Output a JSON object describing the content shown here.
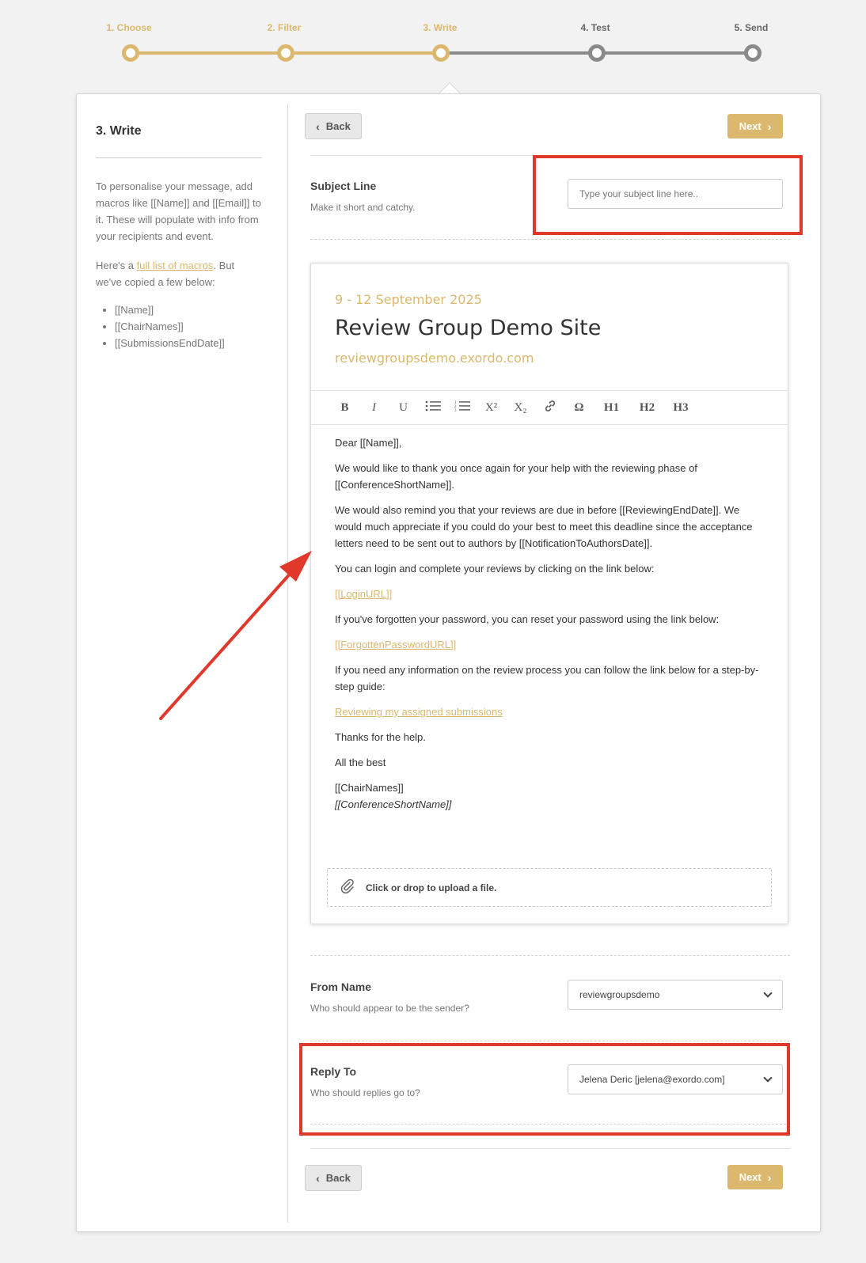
{
  "stepper": {
    "steps": [
      {
        "label": "1. Choose"
      },
      {
        "label": "2. Filter"
      },
      {
        "label": "3. Write"
      },
      {
        "label": "4. Test"
      },
      {
        "label": "5. Send"
      }
    ],
    "current_step": 3
  },
  "sidebar": {
    "title": "3. Write",
    "intro": "To personalise your message, add macros like [[Name]] and [[Email]] to it. These will populate with info from your recipients and event.",
    "macros_prefix": "Here's a ",
    "macros_link": "full list of macros",
    "macros_suffix": ". But we've copied a few below:",
    "macros": [
      "[[Name]]",
      "[[ChairNames]]",
      "[[SubmissionsEndDate]]"
    ]
  },
  "nav": {
    "back_label": "Back",
    "next_label": "Next"
  },
  "subject": {
    "label": "Subject Line",
    "help": "Make it short and catchy.",
    "placeholder": "Type your subject line here.."
  },
  "email": {
    "date": "9 - 12 September 2025",
    "title": "Review Group Demo Site",
    "url": "reviewgroupsdemo.exordo.com",
    "toolbar": [
      "B",
      "I",
      "U",
      "bullet-list",
      "numbered-list",
      "X²",
      "X₂",
      "link",
      "Ω",
      "H1",
      "H2",
      "H3"
    ],
    "greeting": "Dear [[Name]],",
    "p1": "We would like to thank you once again for your help with the reviewing phase of [[ConferenceShortName]].",
    "p2": "We would also remind you that your reviews are due in before [[ReviewingEndDate]]. We would much appreciate if you could do your best to meet this deadline since the acceptance letters need to be sent out to authors by [[NotificationToAuthorsDate]].",
    "p3": "You can login and complete your reviews by clicking on the link below:",
    "login_link": "[[LoginURL]]",
    "p4": "If you've forgotten your password, you can reset your password using the link below:",
    "forgot_link": "[[ForgottenPasswordURL]]",
    "p5": "If you need any information on the review process you can follow the link below for a step-by-step guide:",
    "guide_link": "Reviewing my assigned submissions",
    "p6": "Thanks for the help.",
    "p7": "All the best",
    "sign1": "[[ChairNames]]",
    "sign2": "[[ConferenceShortName]]",
    "upload_label": "Click or drop to upload a file."
  },
  "from_name": {
    "label": "From Name",
    "help": "Who should appear to be the sender?",
    "value": "reviewgroupsdemo"
  },
  "reply_to": {
    "label": "Reply To",
    "help": "Who should replies go to?",
    "value": "Jelena Deric [jelena@exordo.com]"
  },
  "colors": {
    "accent": "#dbb86e",
    "annotation": "#e0392b",
    "inactive": "#8a8a8a"
  }
}
